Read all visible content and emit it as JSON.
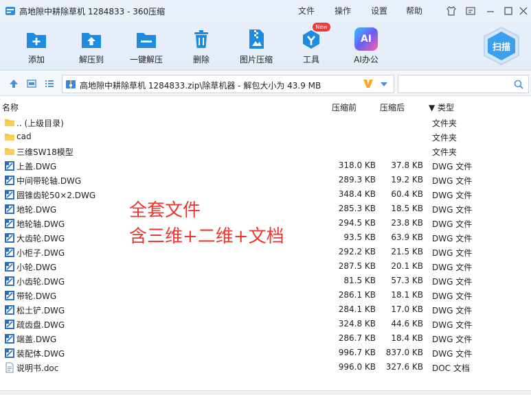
{
  "window": {
    "title": "高地隙中耕除草机 1284833 - 360压缩",
    "menu": [
      "文件",
      "操作",
      "设置",
      "帮助"
    ]
  },
  "toolbar": {
    "add": "添加",
    "extract_to": "解压到",
    "one_click_extract": "一键解压",
    "delete": "删除",
    "image_compress": "图片压缩",
    "tools": "工具",
    "tools_badge": "New",
    "ai_office": "AI办公",
    "ai_icon_text": "AI",
    "scan": "扫描"
  },
  "address": {
    "path": "高地隙中耕除草机 1284833.zip\\除草机器 - 解包大小为 43.9 MB",
    "search_placeholder": ""
  },
  "columns": {
    "name": "名称",
    "compressed": "压缩前",
    "original": "压缩后",
    "type": "▼ 类型"
  },
  "files": [
    {
      "name": ".. (上级目录)",
      "compressed": "",
      "original": "",
      "type": "文件夹",
      "kind": "folder"
    },
    {
      "name": "cad",
      "compressed": "",
      "original": "",
      "type": "文件夹",
      "kind": "folder"
    },
    {
      "name": "三维SW18模型",
      "compressed": "",
      "original": "",
      "type": "文件夹",
      "kind": "folder"
    },
    {
      "name": "上盖.DWG",
      "compressed": "318.0 KB",
      "original": "37.8 KB",
      "type": "DWG 文件",
      "kind": "dwg"
    },
    {
      "name": "中间带轮轴.DWG",
      "compressed": "289.3 KB",
      "original": "19.2 KB",
      "type": "DWG 文件",
      "kind": "dwg"
    },
    {
      "name": "圆锥齿轮50×2.DWG",
      "compressed": "348.4 KB",
      "original": "60.4 KB",
      "type": "DWG 文件",
      "kind": "dwg"
    },
    {
      "name": "地轮.DWG",
      "compressed": "285.3 KB",
      "original": "18.5 KB",
      "type": "DWG 文件",
      "kind": "dwg"
    },
    {
      "name": "地轮轴.DWG",
      "compressed": "294.5 KB",
      "original": "23.8 KB",
      "type": "DWG 文件",
      "kind": "dwg"
    },
    {
      "name": "大齿轮.DWG",
      "compressed": "93.5 KB",
      "original": "63.9 KB",
      "type": "DWG 文件",
      "kind": "dwg"
    },
    {
      "name": "小柜子.DWG",
      "compressed": "292.2 KB",
      "original": "21.5 KB",
      "type": "DWG 文件",
      "kind": "dwg"
    },
    {
      "name": "小轮.DWG",
      "compressed": "287.5 KB",
      "original": "20.1 KB",
      "type": "DWG 文件",
      "kind": "dwg"
    },
    {
      "name": "小齿轮.DWG",
      "compressed": "81.5 KB",
      "original": "57.3 KB",
      "type": "DWG 文件",
      "kind": "dwg"
    },
    {
      "name": "带轮.DWG",
      "compressed": "286.1 KB",
      "original": "18.1 KB",
      "type": "DWG 文件",
      "kind": "dwg"
    },
    {
      "name": "松土铲.DWG",
      "compressed": "284.1 KB",
      "original": "17.0 KB",
      "type": "DWG 文件",
      "kind": "dwg"
    },
    {
      "name": "疏齿盘.DWG",
      "compressed": "324.8 KB",
      "original": "44.6 KB",
      "type": "DWG 文件",
      "kind": "dwg"
    },
    {
      "name": "端盖.DWG",
      "compressed": "286.7 KB",
      "original": "18.4 KB",
      "type": "DWG 文件",
      "kind": "dwg"
    },
    {
      "name": "装配体.DWG",
      "compressed": "996.7 KB",
      "original": "837.0 KB",
      "type": "DWG 文件",
      "kind": "dwg"
    },
    {
      "name": "说明书.doc",
      "compressed": "996.0 KB",
      "original": "327.6 KB",
      "type": "DOC 文档",
      "kind": "doc"
    }
  ],
  "overlay": {
    "line1": "全套文件",
    "line2": "含三维+二维+文档"
  },
  "colors": {
    "accent": "#1e8be0",
    "overlay_text": "#e8372f",
    "folder": "#f5c342"
  }
}
